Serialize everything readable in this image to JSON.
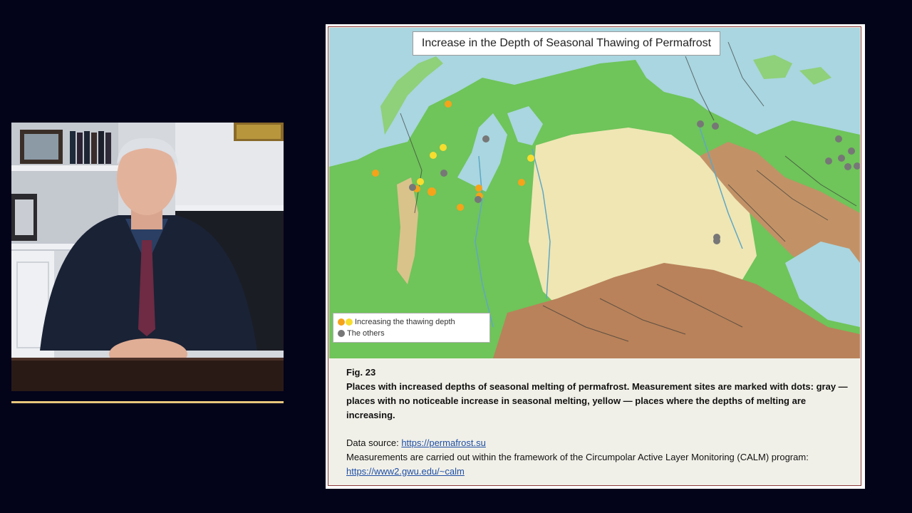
{
  "map": {
    "title": "Increase in the Depth of Seasonal Thawing of Permafrost",
    "legend": [
      {
        "label": "Increasing the thawing depth",
        "swatches": [
          "#f5a31a",
          "#f7dd2e"
        ]
      },
      {
        "label": "The others",
        "swatches": [
          "#777777"
        ]
      }
    ],
    "colors": {
      "sea": "#a9d6e0",
      "lowland": "#6fc45a",
      "upland": "#efe6b4",
      "mountain": "#b9825a",
      "increasing_orange": "#f5a31a",
      "increasing_yellow": "#f7dd2e",
      "other_gray": "#777777"
    }
  },
  "caption": {
    "fig_label": "Fig. 23",
    "description": "Places with increased depths of seasonal melting of permafrost. Measurement sites are marked with dots: gray — places with no noticeable increase in seasonal melting, yellow — places where the depths of melting are increasing.",
    "source_prefix": "Data source: ",
    "source_link": "https://permafrost.su",
    "program_text": "Measurements are carried out within the framework of the Circumpolar Active Layer Monitoring (CALM) program:",
    "program_link": "https://www2.gwu.edu/~calm"
  },
  "colors": {
    "background": "#03031a",
    "slide_border": "#8c3a3a",
    "accent_line": "#e8c77c",
    "link": "#1f4fa6"
  }
}
